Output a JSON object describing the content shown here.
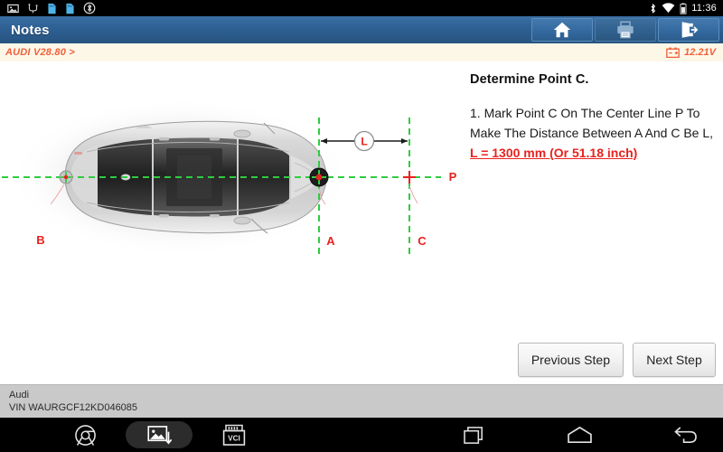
{
  "status_bar": {
    "time": "11:36",
    "icons": [
      "image-icon",
      "usb-debug-icon",
      "sd-card-icon",
      "sd-card-icon",
      "bluetooth-share-icon"
    ],
    "right_icons": [
      "bluetooth-icon",
      "wifi-icon",
      "battery-icon"
    ]
  },
  "title_bar": {
    "title": "Notes",
    "buttons": [
      {
        "name": "home-button",
        "icon": "home-icon",
        "enabled": true
      },
      {
        "name": "print-button",
        "icon": "printer-icon",
        "enabled": false
      },
      {
        "name": "exit-button",
        "icon": "exit-icon",
        "enabled": true
      }
    ]
  },
  "version_bar": {
    "vehicle_version": "AUDI V28.80 >",
    "voltage": "12.21V",
    "battery_icon": "battery-voltage-icon"
  },
  "instructions": {
    "title": "Determine Point C.",
    "step_prefix": "1. Mark Point C On The Center Line P To Make The Distance Between A And C Be L,",
    "highlight": "L = 1300 mm (Or 51.18 inch)"
  },
  "buttons": {
    "previous": "Previous Step",
    "next": "Next Step"
  },
  "diagram": {
    "labels": {
      "point_a": "A",
      "point_b": "B",
      "point_c": "C",
      "line_p": "P",
      "dimension_l": "L"
    },
    "colors": {
      "guide_line": "#2ecc40",
      "label": "#e8221f",
      "dimension": "#1a1a1a"
    },
    "vehicle_view": "top-down-sedan"
  },
  "vehicle_info": {
    "make": "Audi",
    "vin": "VIN WAURGCF12KD046085"
  },
  "nav_bar": {
    "left_items": [
      {
        "name": "browser-icon",
        "label": "chrome"
      },
      {
        "name": "screenshot-icon",
        "label": "screenshot",
        "active": true
      },
      {
        "name": "vci-icon",
        "label": "VCI"
      }
    ],
    "right_items": [
      {
        "name": "recents-icon",
        "label": "recents"
      },
      {
        "name": "home-nav-icon",
        "label": "home"
      },
      {
        "name": "back-icon",
        "label": "back"
      }
    ]
  },
  "theme": {
    "title_bar_color": "#2e6094",
    "accent_orange": "#f0603a",
    "accent_red": "#e8221f",
    "guide_green": "#2ecc40",
    "footer_gray": "#c9c9c9"
  }
}
